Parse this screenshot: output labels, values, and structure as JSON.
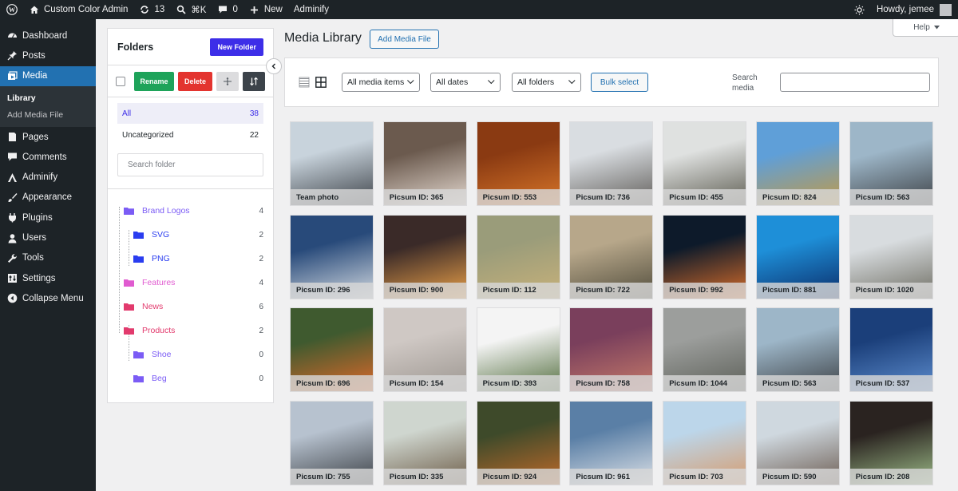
{
  "adminbar": {
    "site_name": "Custom Color Admin",
    "updates_count": "13",
    "search_shortcut": "⌘K",
    "comments_count": "0",
    "new_label": "New",
    "adminify_label": "Adminify",
    "howdy": "Howdy, jemee"
  },
  "sidebar": {
    "items": [
      {
        "label": "Dashboard",
        "icon": "dashboard-icon"
      },
      {
        "label": "Posts",
        "icon": "pin-icon"
      },
      {
        "label": "Media",
        "icon": "media-icon",
        "active": true
      },
      {
        "label": "Pages",
        "icon": "page-icon"
      },
      {
        "label": "Comments",
        "icon": "comment-icon"
      },
      {
        "label": "Adminify",
        "icon": "adminify-icon"
      },
      {
        "label": "Appearance",
        "icon": "brush-icon"
      },
      {
        "label": "Plugins",
        "icon": "plugin-icon"
      },
      {
        "label": "Users",
        "icon": "users-icon"
      },
      {
        "label": "Tools",
        "icon": "wrench-icon"
      },
      {
        "label": "Settings",
        "icon": "settings-icon"
      },
      {
        "label": "Collapse Menu",
        "icon": "collapse-icon"
      }
    ],
    "submenu": [
      "Library",
      "Add Media File"
    ]
  },
  "folders": {
    "title": "Folders",
    "new_folder": "New Folder",
    "rename": "Rename",
    "delete": "Delete",
    "all_label": "All",
    "all_count": "38",
    "uncat_label": "Uncategorized",
    "uncat_count": "22",
    "search_placeholder": "Search folder",
    "tree": [
      {
        "name": "Brand Logos",
        "count": "4",
        "color": "#7b5cf5",
        "level": 0
      },
      {
        "name": "SVG",
        "count": "2",
        "color": "#2a3df0",
        "level": 1
      },
      {
        "name": "PNG",
        "count": "2",
        "color": "#2a3df0",
        "level": 1
      },
      {
        "name": "Features",
        "count": "4",
        "color": "#e05bd0",
        "level": 0
      },
      {
        "name": "News",
        "count": "6",
        "color": "#e23a6d",
        "level": 0
      },
      {
        "name": "Products",
        "count": "2",
        "color": "#e23a6d",
        "level": 0
      },
      {
        "name": "Shoe",
        "count": "0",
        "color": "#7b5cf5",
        "level": 1
      },
      {
        "name": "Beg",
        "count": "0",
        "color": "#7b5cf5",
        "level": 1
      }
    ]
  },
  "main": {
    "title": "Media Library",
    "add_media": "Add Media File",
    "help": "Help",
    "filters": {
      "type": "All media items",
      "dates": "All dates",
      "folders": "All folders"
    },
    "bulk_select": "Bulk select",
    "search_label": "Search media"
  },
  "media": [
    {
      "caption": "Team photo",
      "colors": [
        "#c8d3dc",
        "#3b4046"
      ]
    },
    {
      "caption": "Picsum ID: 365",
      "colors": [
        "#6b5a4e",
        "#e8ddd4"
      ]
    },
    {
      "caption": "Picsum ID: 553",
      "colors": [
        "#8a3a12",
        "#d9772a"
      ]
    },
    {
      "caption": "Picsum ID: 736",
      "colors": [
        "#d9dde1",
        "#5d5a56"
      ]
    },
    {
      "caption": "Picsum ID: 455",
      "colors": [
        "#dfe1e0",
        "#5b5a4f"
      ]
    },
    {
      "caption": "Picsum ID: 824",
      "colors": [
        "#5f9fd8",
        "#c49a44"
      ]
    },
    {
      "caption": "Picsum ID: 563",
      "colors": [
        "#9db6c8",
        "#3b3f43"
      ]
    },
    {
      "caption": "Picsum ID: 296",
      "colors": [
        "#284a7a",
        "#d7dde3"
      ]
    },
    {
      "caption": "Picsum ID: 900",
      "colors": [
        "#3a2a28",
        "#f0a44a"
      ]
    },
    {
      "caption": "Picsum ID: 112",
      "colors": [
        "#9a9c7a",
        "#c9b27a"
      ]
    },
    {
      "caption": "Picsum ID: 722",
      "colors": [
        "#b7a78a",
        "#4e4a3a"
      ]
    },
    {
      "caption": "Picsum ID: 992",
      "colors": [
        "#0d1a2a",
        "#e0702a"
      ]
    },
    {
      "caption": "Picsum ID: 881",
      "colors": [
        "#1e8fd8",
        "#0b2a66"
      ]
    },
    {
      "caption": "Picsum ID: 1020",
      "colors": [
        "#d8dcdf",
        "#6b6a5f"
      ]
    },
    {
      "caption": "Picsum ID: 696",
      "colors": [
        "#3f5a2f",
        "#e2692a"
      ]
    },
    {
      "caption": "Picsum ID: 154",
      "colors": [
        "#cfc8c4",
        "#9b958f"
      ]
    },
    {
      "caption": "Picsum ID: 393",
      "colors": [
        "#f4f4f4",
        "#4f6b3a"
      ]
    },
    {
      "caption": "Picsum ID: 758",
      "colors": [
        "#7a3f5c",
        "#c77c6a"
      ]
    },
    {
      "caption": "Picsum ID: 1044",
      "colors": [
        "#9c9e9c",
        "#5b5e57"
      ]
    },
    {
      "caption": "Picsum ID: 563",
      "colors": [
        "#9db6c8",
        "#3b3f43"
      ]
    },
    {
      "caption": "Picsum ID: 537",
      "colors": [
        "#1b3f7a",
        "#5f8fd0"
      ]
    },
    {
      "caption": "Picsum ID: 755",
      "colors": [
        "#b7c2cf",
        "#3a3e43"
      ]
    },
    {
      "caption": "Picsum ID: 335",
      "colors": [
        "#cfd6cf",
        "#6b5a45"
      ]
    },
    {
      "caption": "Picsum ID: 924",
      "colors": [
        "#3e4a2a",
        "#c26a2a"
      ]
    },
    {
      "caption": "Picsum ID: 961",
      "colors": [
        "#5a7fa6",
        "#dfe3e8"
      ]
    },
    {
      "caption": "Picsum ID: 703",
      "colors": [
        "#bcd6ea",
        "#d79a6a"
      ]
    },
    {
      "caption": "Picsum ID: 590",
      "colors": [
        "#cfd8df",
        "#6a5a4f"
      ]
    },
    {
      "caption": "Picsum ID: 208",
      "colors": [
        "#2a2320",
        "#9fbf8a"
      ]
    }
  ]
}
